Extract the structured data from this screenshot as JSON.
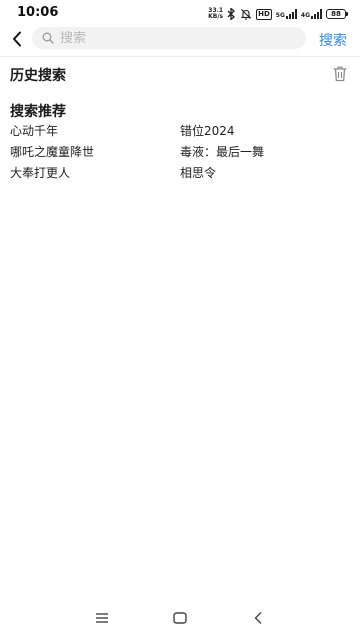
{
  "status_bar": {
    "time": "10:06",
    "net_speed_value": "33.1",
    "net_speed_unit": "KB/s",
    "hd_label": "HD",
    "network_5g": "5G",
    "network_4g": "4G",
    "battery": "88",
    "icons": [
      "bluetooth-icon",
      "mute-bell-icon",
      "hd-icon",
      "signal-5g-icon",
      "signal-4g-icon",
      "battery-icon"
    ]
  },
  "header": {
    "search_placeholder": "搜索",
    "search_value": "",
    "submit_label": "搜索",
    "accent_color": "#2b8cf0"
  },
  "history": {
    "title": "历史搜索",
    "items": []
  },
  "recommend": {
    "title": "搜索推荐",
    "items": [
      "心动千年",
      "错位2024",
      "哪吒之魔童降世",
      "毒液：最后一舞",
      "大奉打更人",
      "相思令"
    ]
  },
  "nav_bar": {
    "icons": [
      "menu-icon",
      "home-icon",
      "back-icon"
    ]
  }
}
